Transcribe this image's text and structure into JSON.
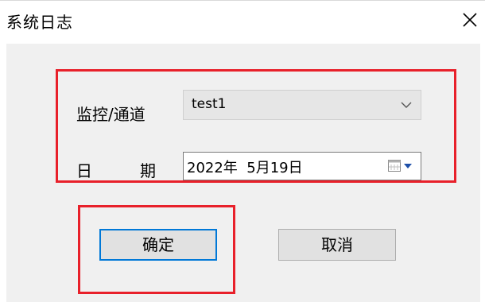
{
  "window": {
    "title": "系统日志"
  },
  "form": {
    "channel_label": "监控/通道",
    "channel_value": "test1",
    "date_label_part1": "日",
    "date_label_part2": "期",
    "date_value": "2022年  5月19日"
  },
  "buttons": {
    "ok_label": "确定",
    "cancel_label": "取消"
  },
  "icons": {
    "close": "close-icon",
    "dropdown": "chevron-down-icon",
    "calendar": "calendar-icon"
  },
  "colors": {
    "highlight_border": "#e8202a",
    "focus_border": "#0078d7",
    "panel_bg": "#f0f0f0"
  }
}
